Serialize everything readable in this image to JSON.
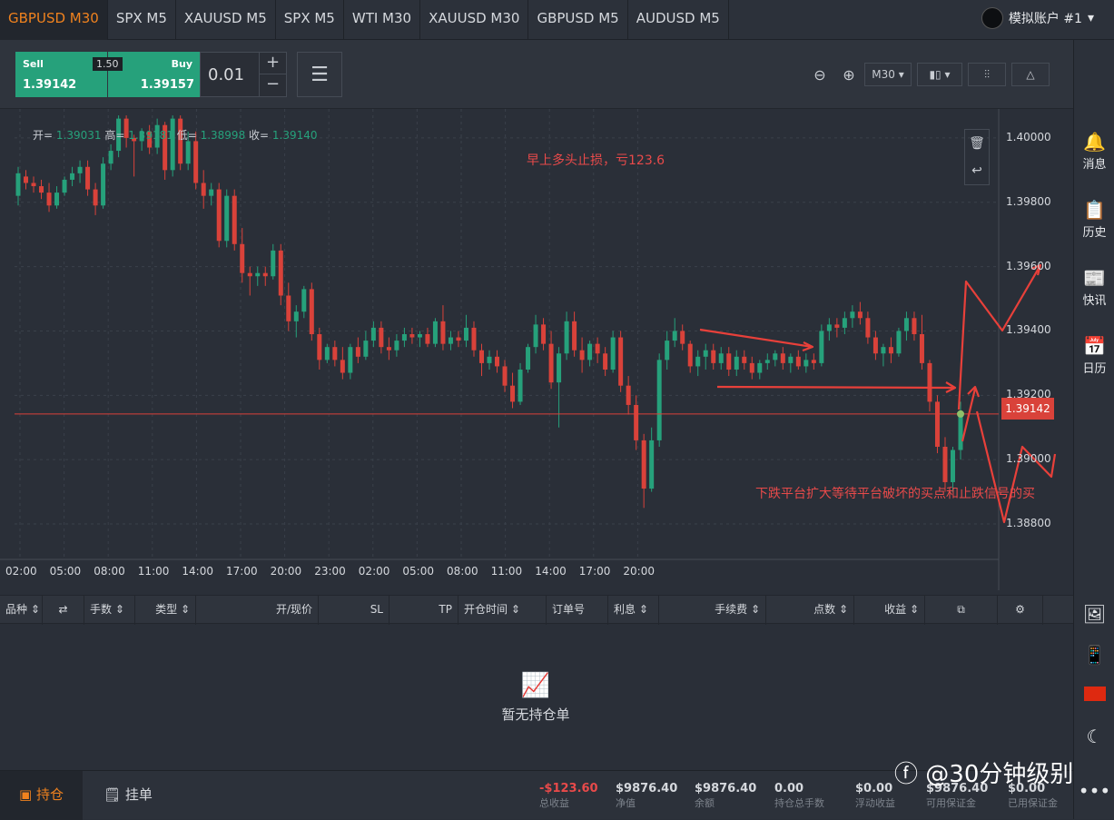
{
  "tabs": [
    "GBPUSD M30",
    "SPX M5",
    "XAUUSD M5",
    "SPX M5",
    "WTI M30",
    "XAUUSD M30",
    "GBPUSD M5",
    "AUDUSD M5"
  ],
  "account": "模拟账户 #1",
  "trade": {
    "sell_label": "Sell",
    "sell_price": "1.39142",
    "buy_label": "Buy",
    "buy_price": "1.39157",
    "spread": "1.50",
    "lot": "0.01",
    "plus": "+",
    "minus": "−"
  },
  "timeframe": "M30",
  "ohlc": {
    "open_label": "开=",
    "open": "1.39031",
    "high_label": "高=",
    "high": "1.39181",
    "low_label": "低=",
    "low": "1.38998",
    "close_label": "收=",
    "close": "1.39140"
  },
  "annotations": {
    "top": "早上多头止损，亏123.6",
    "bottom": "下跌平台扩大等待平台破坏的买点和止跌信号的买"
  },
  "current_price": "1.39142",
  "y_axis": [
    "1.40000",
    "1.39800",
    "1.39600",
    "1.39400",
    "1.39200",
    "1.39000",
    "1.38800"
  ],
  "x_axis": [
    "02:00",
    "05:00",
    "08:00",
    "11:00",
    "14:00",
    "17:00",
    "20:00",
    "23:00",
    "02:00",
    "05:00",
    "08:00",
    "11:00",
    "14:00",
    "17:00",
    "20:00"
  ],
  "sidebar": [
    "消息",
    "历史",
    "快讯",
    "日历"
  ],
  "table_headers": [
    "品种",
    "手数",
    "类型",
    "开/现价",
    "SL",
    "TP",
    "开仓时间",
    "订单号",
    "利息",
    "手续费",
    "点数",
    "收益"
  ],
  "empty_text": "暂无持仓单",
  "footer": {
    "tab_positions": "持仓",
    "tab_orders": "挂单",
    "stats": [
      {
        "value": "-$123.60",
        "label": "总收益"
      },
      {
        "value": "$9876.40",
        "label": "净值"
      },
      {
        "value": "$9876.40",
        "label": "余额"
      },
      {
        "value": "0.00",
        "label": "持仓总手数"
      },
      {
        "value": "$0.00",
        "label": "浮动收益"
      },
      {
        "value": "$9876.40",
        "label": "可用保证金"
      },
      {
        "value": "$0.00",
        "label": "已用保证金"
      }
    ]
  },
  "watermark": "@30分钟级别",
  "colors": {
    "up": "#26a17b",
    "down": "#d9423a",
    "accent": "#f0821e"
  },
  "chart_data": {
    "type": "candlestick",
    "symbol": "GBPUSD",
    "timeframe": "M30",
    "ylim": [
      1.3869,
      1.4009
    ],
    "candles": [
      {
        "o": 1.3982,
        "h": 1.3991,
        "l": 1.3979,
        "c": 1.3989
      },
      {
        "o": 1.3988,
        "h": 1.399,
        "l": 1.3984,
        "c": 1.3986
      },
      {
        "o": 1.3986,
        "h": 1.3988,
        "l": 1.3983,
        "c": 1.3985
      },
      {
        "o": 1.3985,
        "h": 1.3987,
        "l": 1.3981,
        "c": 1.3983
      },
      {
        "o": 1.3983,
        "h": 1.3986,
        "l": 1.3977,
        "c": 1.3979
      },
      {
        "o": 1.3979,
        "h": 1.3985,
        "l": 1.3978,
        "c": 1.3983
      },
      {
        "o": 1.3983,
        "h": 1.3988,
        "l": 1.3982,
        "c": 1.3987
      },
      {
        "o": 1.3987,
        "h": 1.3991,
        "l": 1.3985,
        "c": 1.3989
      },
      {
        "o": 1.3989,
        "h": 1.3993,
        "l": 1.3986,
        "c": 1.3991
      },
      {
        "o": 1.3991,
        "h": 1.3993,
        "l": 1.3982,
        "c": 1.3984
      },
      {
        "o": 1.3984,
        "h": 1.3986,
        "l": 1.3976,
        "c": 1.3979
      },
      {
        "o": 1.3979,
        "h": 1.3994,
        "l": 1.3978,
        "c": 1.3992
      },
      {
        "o": 1.3992,
        "h": 1.3998,
        "l": 1.399,
        "c": 1.3996
      },
      {
        "o": 1.3996,
        "h": 1.4007,
        "l": 1.3994,
        "c": 1.4006
      },
      {
        "o": 1.4006,
        "h": 1.4007,
        "l": 1.3997,
        "c": 1.4
      },
      {
        "o": 1.4,
        "h": 1.4001,
        "l": 1.3988,
        "c": 1.3999
      },
      {
        "o": 1.3999,
        "h": 1.4003,
        "l": 1.3996,
        "c": 1.4002
      },
      {
        "o": 1.4002,
        "h": 1.4004,
        "l": 1.3995,
        "c": 1.3997
      },
      {
        "o": 1.3997,
        "h": 1.4006,
        "l": 1.3995,
        "c": 1.4004
      },
      {
        "o": 1.4004,
        "h": 1.4005,
        "l": 1.3987,
        "c": 1.399
      },
      {
        "o": 1.399,
        "h": 1.4007,
        "l": 1.3988,
        "c": 1.4006
      },
      {
        "o": 1.4006,
        "h": 1.4007,
        "l": 1.399,
        "c": 1.3992
      },
      {
        "o": 1.3992,
        "h": 1.4002,
        "l": 1.399,
        "c": 1.3999
      },
      {
        "o": 1.3999,
        "h": 1.4002,
        "l": 1.3984,
        "c": 1.3986
      },
      {
        "o": 1.3986,
        "h": 1.399,
        "l": 1.3978,
        "c": 1.3982
      },
      {
        "o": 1.3982,
        "h": 1.3986,
        "l": 1.3979,
        "c": 1.3984
      },
      {
        "o": 1.3984,
        "h": 1.3986,
        "l": 1.3966,
        "c": 1.3968
      },
      {
        "o": 1.3968,
        "h": 1.3984,
        "l": 1.3966,
        "c": 1.3982
      },
      {
        "o": 1.3982,
        "h": 1.3984,
        "l": 1.3965,
        "c": 1.3967
      },
      {
        "o": 1.3967,
        "h": 1.3972,
        "l": 1.3955,
        "c": 1.3958
      },
      {
        "o": 1.3958,
        "h": 1.396,
        "l": 1.3951,
        "c": 1.3957
      },
      {
        "o": 1.3957,
        "h": 1.396,
        "l": 1.3954,
        "c": 1.3958
      },
      {
        "o": 1.3958,
        "h": 1.396,
        "l": 1.3954,
        "c": 1.3957
      },
      {
        "o": 1.3957,
        "h": 1.3967,
        "l": 1.3956,
        "c": 1.3965
      },
      {
        "o": 1.3965,
        "h": 1.3967,
        "l": 1.3948,
        "c": 1.3951
      },
      {
        "o": 1.3951,
        "h": 1.3955,
        "l": 1.394,
        "c": 1.3943
      },
      {
        "o": 1.3943,
        "h": 1.3948,
        "l": 1.3938,
        "c": 1.3946
      },
      {
        "o": 1.3946,
        "h": 1.3954,
        "l": 1.3944,
        "c": 1.3953
      },
      {
        "o": 1.3953,
        "h": 1.3955,
        "l": 1.3937,
        "c": 1.3939
      },
      {
        "o": 1.3939,
        "h": 1.3941,
        "l": 1.3928,
        "c": 1.3931
      },
      {
        "o": 1.3931,
        "h": 1.3936,
        "l": 1.393,
        "c": 1.3935
      },
      {
        "o": 1.3935,
        "h": 1.3937,
        "l": 1.3929,
        "c": 1.3931
      },
      {
        "o": 1.3931,
        "h": 1.3935,
        "l": 1.3925,
        "c": 1.3927
      },
      {
        "o": 1.3927,
        "h": 1.3936,
        "l": 1.3925,
        "c": 1.3935
      },
      {
        "o": 1.3935,
        "h": 1.3938,
        "l": 1.393,
        "c": 1.3932
      },
      {
        "o": 1.3932,
        "h": 1.394,
        "l": 1.3931,
        "c": 1.3937
      },
      {
        "o": 1.3937,
        "h": 1.3943,
        "l": 1.3935,
        "c": 1.3941
      },
      {
        "o": 1.3941,
        "h": 1.3943,
        "l": 1.3933,
        "c": 1.3935
      },
      {
        "o": 1.3935,
        "h": 1.3938,
        "l": 1.3931,
        "c": 1.3934
      },
      {
        "o": 1.3934,
        "h": 1.3939,
        "l": 1.3932,
        "c": 1.3937
      },
      {
        "o": 1.3937,
        "h": 1.3941,
        "l": 1.3935,
        "c": 1.3939
      },
      {
        "o": 1.3939,
        "h": 1.3941,
        "l": 1.3936,
        "c": 1.3938
      },
      {
        "o": 1.3938,
        "h": 1.394,
        "l": 1.3935,
        "c": 1.3939
      },
      {
        "o": 1.3939,
        "h": 1.3941,
        "l": 1.3935,
        "c": 1.3936
      },
      {
        "o": 1.3936,
        "h": 1.3944,
        "l": 1.3935,
        "c": 1.3943
      },
      {
        "o": 1.3943,
        "h": 1.3948,
        "l": 1.3934,
        "c": 1.3936
      },
      {
        "o": 1.3936,
        "h": 1.394,
        "l": 1.3934,
        "c": 1.3938
      },
      {
        "o": 1.3938,
        "h": 1.394,
        "l": 1.3935,
        "c": 1.3937
      },
      {
        "o": 1.3937,
        "h": 1.3945,
        "l": 1.3935,
        "c": 1.3941
      },
      {
        "o": 1.3941,
        "h": 1.3943,
        "l": 1.3932,
        "c": 1.3934
      },
      {
        "o": 1.3934,
        "h": 1.3936,
        "l": 1.3926,
        "c": 1.393
      },
      {
        "o": 1.393,
        "h": 1.3934,
        "l": 1.3928,
        "c": 1.3932
      },
      {
        "o": 1.3932,
        "h": 1.3934,
        "l": 1.3927,
        "c": 1.3929
      },
      {
        "o": 1.3929,
        "h": 1.3931,
        "l": 1.3921,
        "c": 1.3923
      },
      {
        "o": 1.3923,
        "h": 1.3927,
        "l": 1.3916,
        "c": 1.3918
      },
      {
        "o": 1.3918,
        "h": 1.393,
        "l": 1.3917,
        "c": 1.3928
      },
      {
        "o": 1.3928,
        "h": 1.3936,
        "l": 1.3927,
        "c": 1.3935
      },
      {
        "o": 1.3935,
        "h": 1.3945,
        "l": 1.3933,
        "c": 1.3942
      },
      {
        "o": 1.3942,
        "h": 1.3944,
        "l": 1.3934,
        "c": 1.3936
      },
      {
        "o": 1.3936,
        "h": 1.394,
        "l": 1.3922,
        "c": 1.3924
      },
      {
        "o": 1.3924,
        "h": 1.3935,
        "l": 1.391,
        "c": 1.3933
      },
      {
        "o": 1.3933,
        "h": 1.3946,
        "l": 1.3931,
        "c": 1.3943
      },
      {
        "o": 1.3943,
        "h": 1.3946,
        "l": 1.3932,
        "c": 1.3934
      },
      {
        "o": 1.3934,
        "h": 1.3938,
        "l": 1.3927,
        "c": 1.3931
      },
      {
        "o": 1.3931,
        "h": 1.3937,
        "l": 1.3929,
        "c": 1.3936
      },
      {
        "o": 1.3936,
        "h": 1.3938,
        "l": 1.393,
        "c": 1.3933
      },
      {
        "o": 1.3933,
        "h": 1.3935,
        "l": 1.3926,
        "c": 1.3928
      },
      {
        "o": 1.3928,
        "h": 1.394,
        "l": 1.3927,
        "c": 1.3938
      },
      {
        "o": 1.3938,
        "h": 1.394,
        "l": 1.3921,
        "c": 1.3923
      },
      {
        "o": 1.3923,
        "h": 1.3926,
        "l": 1.3914,
        "c": 1.3917
      },
      {
        "o": 1.3917,
        "h": 1.392,
        "l": 1.3903,
        "c": 1.3906
      },
      {
        "o": 1.3906,
        "h": 1.3908,
        "l": 1.3885,
        "c": 1.3891
      },
      {
        "o": 1.3891,
        "h": 1.391,
        "l": 1.389,
        "c": 1.3906
      },
      {
        "o": 1.3906,
        "h": 1.3933,
        "l": 1.3904,
        "c": 1.3931
      },
      {
        "o": 1.3931,
        "h": 1.394,
        "l": 1.3928,
        "c": 1.3937
      },
      {
        "o": 1.3937,
        "h": 1.3944,
        "l": 1.3935,
        "c": 1.394
      },
      {
        "o": 1.394,
        "h": 1.3942,
        "l": 1.3934,
        "c": 1.3936
      },
      {
        "o": 1.3936,
        "h": 1.3937,
        "l": 1.3927,
        "c": 1.3929
      },
      {
        "o": 1.3929,
        "h": 1.3934,
        "l": 1.3926,
        "c": 1.3932
      },
      {
        "o": 1.3932,
        "h": 1.3936,
        "l": 1.3928,
        "c": 1.3934
      },
      {
        "o": 1.3934,
        "h": 1.3936,
        "l": 1.3928,
        "c": 1.393
      },
      {
        "o": 1.393,
        "h": 1.3935,
        "l": 1.3928,
        "c": 1.3933
      },
      {
        "o": 1.3933,
        "h": 1.3935,
        "l": 1.3926,
        "c": 1.3928
      },
      {
        "o": 1.3928,
        "h": 1.3934,
        "l": 1.3926,
        "c": 1.3932
      },
      {
        "o": 1.3932,
        "h": 1.3934,
        "l": 1.3928,
        "c": 1.393
      },
      {
        "o": 1.393,
        "h": 1.3932,
        "l": 1.3925,
        "c": 1.3927
      },
      {
        "o": 1.3927,
        "h": 1.3931,
        "l": 1.3925,
        "c": 1.393
      },
      {
        "o": 1.393,
        "h": 1.3933,
        "l": 1.3928,
        "c": 1.3931
      },
      {
        "o": 1.3931,
        "h": 1.3934,
        "l": 1.3929,
        "c": 1.3933
      },
      {
        "o": 1.3933,
        "h": 1.3935,
        "l": 1.3928,
        "c": 1.393
      },
      {
        "o": 1.393,
        "h": 1.3933,
        "l": 1.3927,
        "c": 1.3932
      },
      {
        "o": 1.3932,
        "h": 1.3934,
        "l": 1.3928,
        "c": 1.3929
      },
      {
        "o": 1.3929,
        "h": 1.3933,
        "l": 1.3927,
        "c": 1.3931
      },
      {
        "o": 1.3931,
        "h": 1.3933,
        "l": 1.3928,
        "c": 1.393
      },
      {
        "o": 1.393,
        "h": 1.3942,
        "l": 1.3929,
        "c": 1.394
      },
      {
        "o": 1.394,
        "h": 1.3944,
        "l": 1.3937,
        "c": 1.3942
      },
      {
        "o": 1.3942,
        "h": 1.3944,
        "l": 1.3938,
        "c": 1.3941
      },
      {
        "o": 1.3941,
        "h": 1.3946,
        "l": 1.3939,
        "c": 1.3944
      },
      {
        "o": 1.3944,
        "h": 1.3948,
        "l": 1.3941,
        "c": 1.3946
      },
      {
        "o": 1.3946,
        "h": 1.3949,
        "l": 1.3942,
        "c": 1.3944
      },
      {
        "o": 1.3944,
        "h": 1.3946,
        "l": 1.3936,
        "c": 1.3938
      },
      {
        "o": 1.3938,
        "h": 1.394,
        "l": 1.3931,
        "c": 1.3933
      },
      {
        "o": 1.3933,
        "h": 1.3936,
        "l": 1.3929,
        "c": 1.3935
      },
      {
        "o": 1.3935,
        "h": 1.3938,
        "l": 1.393,
        "c": 1.3933
      },
      {
        "o": 1.3933,
        "h": 1.3941,
        "l": 1.3932,
        "c": 1.394
      },
      {
        "o": 1.394,
        "h": 1.3946,
        "l": 1.3937,
        "c": 1.3944
      },
      {
        "o": 1.3944,
        "h": 1.3946,
        "l": 1.3937,
        "c": 1.3939
      },
      {
        "o": 1.3939,
        "h": 1.3945,
        "l": 1.3928,
        "c": 1.393
      },
      {
        "o": 1.393,
        "h": 1.3931,
        "l": 1.3915,
        "c": 1.3918
      },
      {
        "o": 1.3918,
        "h": 1.392,
        "l": 1.3902,
        "c": 1.3904
      },
      {
        "o": 1.3904,
        "h": 1.3907,
        "l": 1.389,
        "c": 1.3893
      },
      {
        "o": 1.3893,
        "h": 1.3904,
        "l": 1.389,
        "c": 1.3903
      },
      {
        "o": 1.3903,
        "h": 1.3918,
        "l": 1.39,
        "c": 1.3914
      }
    ]
  }
}
